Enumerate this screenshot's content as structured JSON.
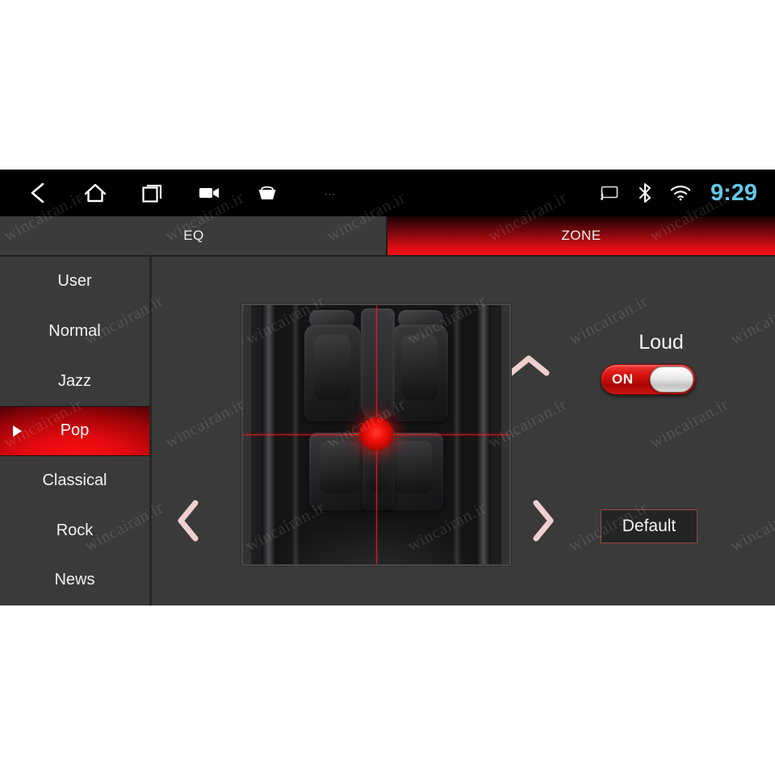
{
  "statusbar": {
    "icons": [
      "back-icon",
      "home-icon",
      "recents-icon",
      "video-camera-icon",
      "basket-icon",
      "overflow-dots-icon"
    ],
    "dots": "···",
    "right_icons": [
      "cast-icon",
      "bluetooth-icon",
      "wifi-icon"
    ],
    "clock": "9:29",
    "clock_color": "#63c8e8"
  },
  "tabs": [
    {
      "label": "EQ",
      "active": false
    },
    {
      "label": "ZONE",
      "active": true
    }
  ],
  "sidebar": {
    "presets": [
      {
        "label": "User",
        "selected": false
      },
      {
        "label": "Normal",
        "selected": false
      },
      {
        "label": "Jazz",
        "selected": false
      },
      {
        "label": "Pop",
        "selected": true
      },
      {
        "label": "Classical",
        "selected": false
      },
      {
        "label": "Rock",
        "selected": false
      },
      {
        "label": "News",
        "selected": false
      }
    ]
  },
  "zone": {
    "nudge_up": "chevron-up-icon",
    "nudge_down": "chevron-down-icon",
    "nudge_left": "chevron-left-icon",
    "nudge_right": "chevron-right-icon",
    "seat_map_alt": "car-interior-top-view",
    "focus_point": "center"
  },
  "controls": {
    "loud_label": "Loud",
    "loud_state": "ON",
    "default_label": "Default"
  },
  "theme": {
    "accent_red": "#e30a0f",
    "panel_bg": "#3a3a3a",
    "statusbar_bg": "#000000"
  },
  "watermark": {
    "text": "wincairan.ir"
  }
}
